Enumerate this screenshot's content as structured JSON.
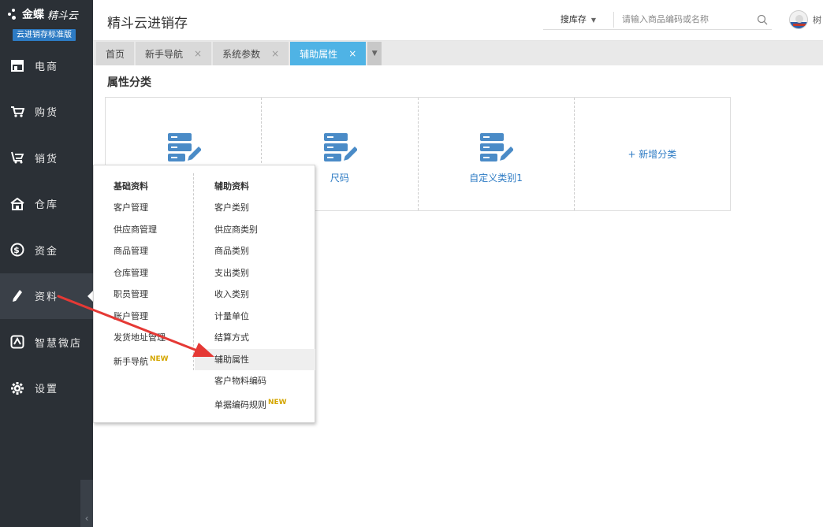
{
  "brand": {
    "logo_text": "金蝶",
    "logo_sub": "精斗云",
    "edition": "云进销存标准版"
  },
  "sidebar": {
    "items": [
      {
        "label": "电商",
        "icon": "store-icon"
      },
      {
        "label": "购货",
        "icon": "cart-icon"
      },
      {
        "label": "销货",
        "icon": "sales-cart-icon"
      },
      {
        "label": "仓库",
        "icon": "warehouse-icon"
      },
      {
        "label": "资金",
        "icon": "dollar-icon"
      },
      {
        "label": "资料",
        "icon": "pencil-icon"
      },
      {
        "label": "智慧微店",
        "icon": "shop-icon"
      },
      {
        "label": "设置",
        "icon": "gear-icon"
      }
    ],
    "active_index": 5,
    "collapse_label": "‹"
  },
  "header": {
    "title": "精斗云进销存",
    "search_scope": "搜库存",
    "search_placeholder": "请输入商品编码或名称",
    "user_cut_label": "树"
  },
  "tabs": [
    {
      "label": "首页",
      "closable": false
    },
    {
      "label": "新手导航",
      "closable": true
    },
    {
      "label": "系统参数",
      "closable": true
    },
    {
      "label": "辅助属性",
      "closable": true,
      "active": true
    }
  ],
  "tab_close_glyph": "×",
  "main": {
    "page_title": "属性分类",
    "categories": [
      {
        "label": ""
      },
      {
        "label": "尺码"
      },
      {
        "label": "自定义类别1"
      }
    ],
    "add_label": "+ 新增分类"
  },
  "menu": {
    "left": {
      "heading": "基础资料",
      "items": [
        "客户管理",
        "供应商管理",
        "商品管理",
        "仓库管理",
        "职员管理",
        "账户管理",
        "发货地址管理",
        "新手导航"
      ],
      "new_index": 7
    },
    "right": {
      "heading": "辅助资料",
      "items": [
        "客户类别",
        "供应商类别",
        "商品类别",
        "支出类别",
        "收入类别",
        "计量单位",
        "结算方式",
        "辅助属性",
        "客户物料编码",
        "单据编码规则"
      ],
      "highlight_index": 7,
      "new_index": 9
    },
    "new_tag": "NEW"
  },
  "colors": {
    "sidebar_bg": "#2b3036",
    "accent": "#4fb3e5",
    "link_blue": "#2d7bc4",
    "icon_blue": "#4a8bc7",
    "arrow_red": "#e53935"
  }
}
